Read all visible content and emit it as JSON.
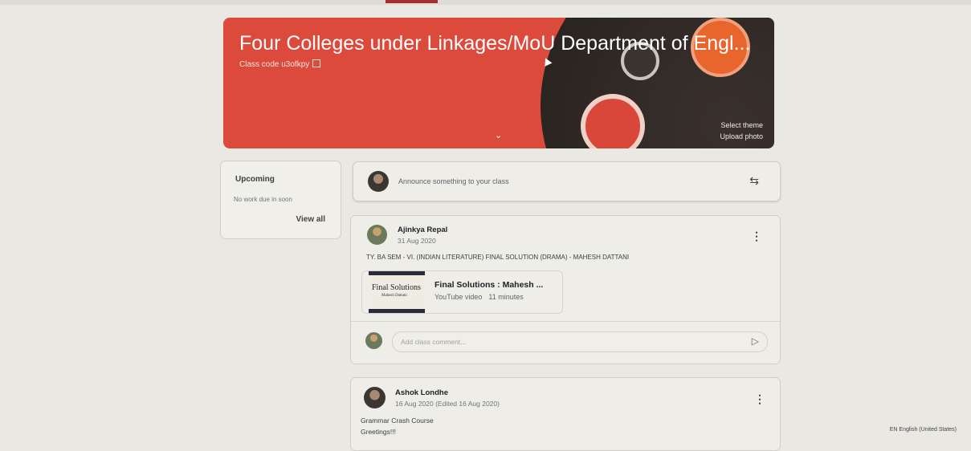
{
  "banner": {
    "title": "Four Colleges under Linkages/MoU Department of Engl...",
    "class_code": "Class code  u3ofkpy",
    "select_theme": "Select theme",
    "upload_photo": "Upload photo",
    "theme_color": "#db4a3b"
  },
  "upcoming": {
    "heading": "Upcoming",
    "status": "No work due in soon",
    "view_all": "View all"
  },
  "announce": {
    "placeholder": "Announce something to your class"
  },
  "posts": [
    {
      "author": "Ajinkya Repal",
      "date": "31 Aug 2020",
      "body": "TY. BA SEM - VI. (INDIAN LITERATURE) FINAL SOLUTION (DRAMA) - MAHESH DATTANI",
      "attachment": {
        "thumb_title": "Final Solutions",
        "thumb_sub": "Mahesh Dattani",
        "title": "Final Solutions : Mahesh ...",
        "type": "YouTube video",
        "duration": "11 minutes"
      },
      "comment_placeholder": "Add class comment..."
    },
    {
      "author": "Ashok Londhe",
      "date": "16 Aug 2020 (Edited 16 Aug 2020)",
      "line1": "Grammar Crash Course",
      "line2": "Greetings!!!"
    }
  ],
  "footer": {
    "language": "EN English (United States)"
  }
}
